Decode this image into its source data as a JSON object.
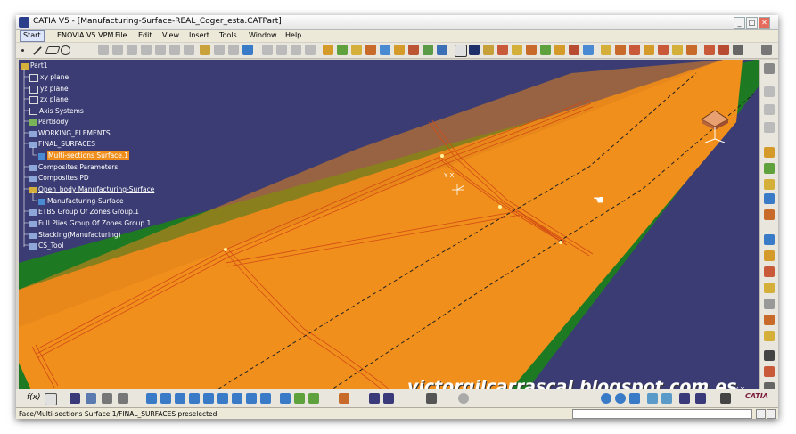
{
  "window": {
    "title": "CATIA V5 - [Manufacturing-Surface-REAL_Coger_esta.CATPart]",
    "minimize": "_",
    "maximize": "□",
    "close": "✕"
  },
  "menu": {
    "start": "Start",
    "items": [
      "ENOVIA V5 VPM",
      "File",
      "Edit",
      "View",
      "Insert",
      "Tools",
      "Window",
      "Help"
    ]
  },
  "tree": [
    {
      "label": "Part1"
    },
    {
      "label": "xy plane"
    },
    {
      "label": "yz plane"
    },
    {
      "label": "zx plane"
    },
    {
      "label": "Axis Systems"
    },
    {
      "label": "PartBody"
    },
    {
      "label": "WORKING_ELEMENTS"
    },
    {
      "label": "FINAL_SURFACES"
    },
    {
      "label": "Multi-sections Surface.1"
    },
    {
      "label": "Composites Parameters"
    },
    {
      "label": "Composites PD"
    },
    {
      "label": "Open_body Manufacturing-Surface"
    },
    {
      "label": "Manufacturing-Surface"
    },
    {
      "label": "ETBS Group Of Zones Group.1"
    },
    {
      "label": "Full Plies Group Of Zones Group.1"
    },
    {
      "label": "Stacking(Manufacturing)"
    },
    {
      "label": "CS_Tool"
    }
  ],
  "viewport": {
    "watermark": "victorgilcarrascal.blogspot.com.es",
    "axis_small": "Y  X",
    "axis_corner": "Y  X"
  },
  "status": {
    "text": "Face/Multi-sections Surface.1/FINAL_SURFACES preselected",
    "input_value": "",
    "logo": "CATIA"
  },
  "colors": {
    "surface_orange": "#f08f1c",
    "border_green": "#1e7a22",
    "background": "#3a3c73",
    "highlight": "#f08f1c"
  }
}
